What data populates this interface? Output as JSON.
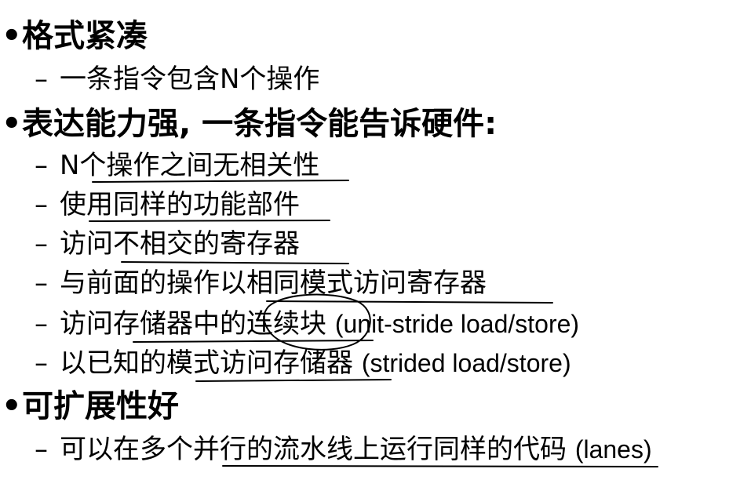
{
  "bullet_glyph": "•",
  "dash_glyph": "–",
  "items": [
    {
      "title": "格式紧凑",
      "subs": [
        {
          "text": "一条指令包含N个操作",
          "note": ""
        }
      ]
    },
    {
      "title": "表达能力强, 一条指令能告诉硬件:",
      "subs": [
        {
          "text": "N个操作之间无相关性",
          "note": ""
        },
        {
          "text": "使用同样的功能部件",
          "note": ""
        },
        {
          "text": "访问不相交的寄存器",
          "note": ""
        },
        {
          "text": "与前面的操作以相同模式访问寄存器",
          "note": ""
        },
        {
          "text": "访问存储器中的连续块",
          "note": "(unit-stride load/store)"
        },
        {
          "text": "以已知的模式访问存储器",
          "note": "(strided load/store)"
        }
      ]
    },
    {
      "title": "可扩展性好",
      "subs": [
        {
          "text": "可以在多个并行的流水线上运行同样的代码",
          "note": "(lanes)"
        }
      ]
    }
  ]
}
